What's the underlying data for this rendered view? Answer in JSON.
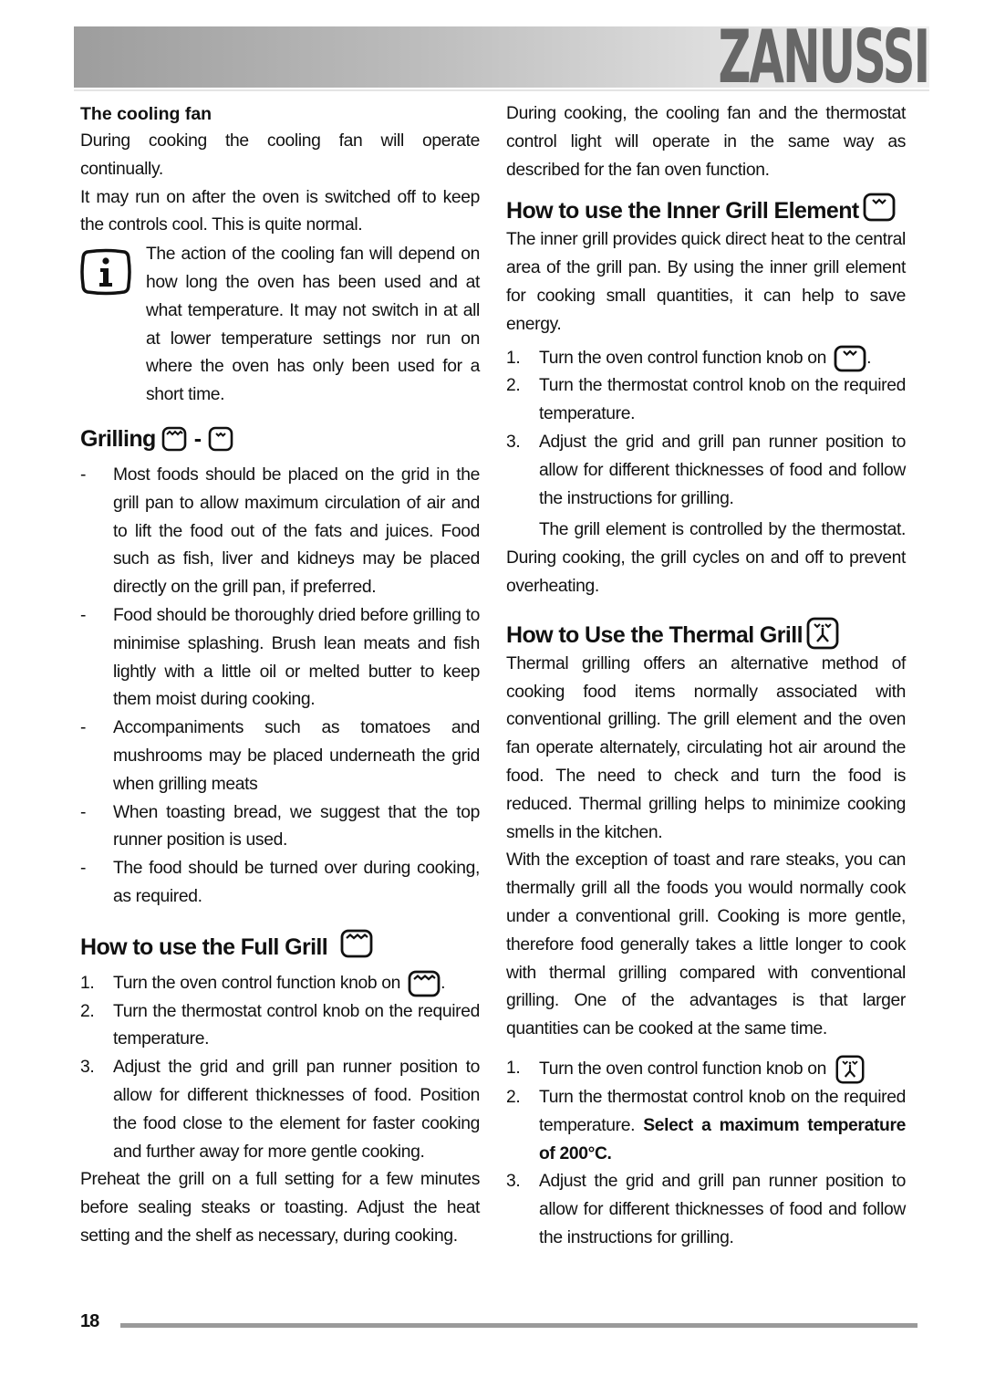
{
  "header": {
    "brand": "ZANUSSI"
  },
  "left": {
    "cooling_fan": {
      "title": "The cooling fan",
      "p1": "During cooking the cooling fan will operate continually.",
      "p2": "It may run on after the oven is switched off to keep the controls cool. This is quite normal.",
      "info_note": "The action of the cooling fan will depend on how long the oven has been used and at what temperature. It may not switch in at all at lower temperature settings nor run on where the oven has only been used for a short time."
    },
    "grilling": {
      "title": "Grilling",
      "separator": "-",
      "icons": [
        "full-grill-icon",
        "inner-grill-icon"
      ],
      "bullets": [
        "Most foods should be placed on the grid in the grill pan to allow maximum circulation of air and to lift the food out of the fats and juices. Food such as fish, liver and kidneys may be placed directly on the grill pan, if preferred.",
        "Food should be thoroughly dried before grilling to minimise splashing. Brush lean meats and fish lightly with a little oil or melted butter to keep them moist during cooking.",
        "Accompaniments such as tomatoes and mushrooms may be placed underneath the grid when grilling meats",
        "When toasting bread, we suggest that the top runner position is used.",
        "The food should be turned over during cooking, as required."
      ]
    },
    "full_grill": {
      "title": "How to use the Full Grill",
      "icon": "full-grill-icon",
      "steps": [
        {
          "num": "1.",
          "text": "Turn the oven control function knob on",
          "suffix": "."
        },
        {
          "num": "2.",
          "text": "Turn the thermostat control knob on the required temperature."
        },
        {
          "num": "3.",
          "text": "Adjust the grid and grill pan runner position to allow for different thicknesses of food. Position the food close to the element for faster cooking and further away for more gentle cooking."
        }
      ],
      "note": "Preheat the grill on a full setting  for a  few minutes before sealing steaks or toasting. Adjust the heat setting and the shelf as necessary, during cooking."
    }
  },
  "right": {
    "intro": "During cooking, the cooling fan and the thermostat control light will operate in the same way as described for the fan oven function.",
    "inner_grill": {
      "title": "How to use the Inner Grill Element",
      "icon": "inner-grill-icon",
      "p1": "The inner grill provides quick direct heat to the central area of the grill pan. By using the inner grill element for cooking small quantities, it can help to save energy.",
      "steps": [
        {
          "num": "1.",
          "text": "Turn the oven control function knob on",
          "suffix": "."
        },
        {
          "num": "2.",
          "text": "Turn the thermostat control knob on the required temperature."
        },
        {
          "num": "3.",
          "text": "Adjust the grid and grill pan runner position to allow for different thicknesses of food and follow the instructions for grilling."
        }
      ],
      "note": "The grill element is controlled by the thermostat. During cooking, the grill cycles on and off to prevent overheating."
    },
    "thermal_grill": {
      "title": "How to Use the Thermal Grill",
      "icon": "thermal-grill-icon",
      "p1": "Thermal grilling offers an alternative method of cooking food items normally associated with conventional grilling. The grill element and the oven fan operate alternately, circulating hot air around the food. The need to check and turn the food is reduced. Thermal grilling helps to minimize cooking smells in the kitchen.",
      "p2": "With the exception of toast and rare steaks, you can thermally grill all the foods you would normally cook under a conventional grill. Cooking is more gentle, therefore food generally takes a little longer to cook with thermal grilling compared with conventional grilling. One of the advantages is that larger quantities can be cooked at the same time.",
      "steps": [
        {
          "num": "1.",
          "text": "Turn the oven control function knob on"
        },
        {
          "num": "2.",
          "text": "Turn the thermostat control knob on the required temperature.",
          "bold": "Select a maximum temperature of 200°C."
        },
        {
          "num": "3.",
          "text": "Adjust the grid and grill pan runner position to allow for different thicknesses of food and follow the instructions for grilling."
        }
      ]
    }
  },
  "footer": {
    "page_number": "18"
  }
}
